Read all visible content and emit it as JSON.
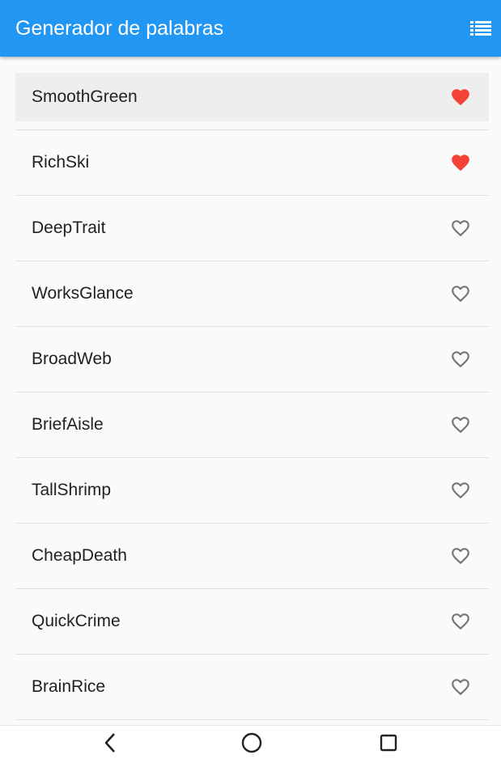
{
  "appbar": {
    "title": "Generador de palabras",
    "action_icon": "list-icon",
    "background": "#2196f3"
  },
  "words": [
    {
      "label": "SmoothGreen",
      "favorite": true
    },
    {
      "label": "RichSki",
      "favorite": true
    },
    {
      "label": "DeepTrait",
      "favorite": false
    },
    {
      "label": "WorksGlance",
      "favorite": false
    },
    {
      "label": "BroadWeb",
      "favorite": false
    },
    {
      "label": "BriefAisle",
      "favorite": false
    },
    {
      "label": "TallShrimp",
      "favorite": false
    },
    {
      "label": "CheapDeath",
      "favorite": false
    },
    {
      "label": "QuickCrime",
      "favorite": false
    },
    {
      "label": "BrainRice",
      "favorite": false
    }
  ],
  "colors": {
    "favorite": "#f44336",
    "unfavorite": "#757575",
    "highlight": "#eeeeee"
  },
  "navbar": {
    "icons": [
      "back-icon",
      "home-icon",
      "recents-icon"
    ]
  }
}
